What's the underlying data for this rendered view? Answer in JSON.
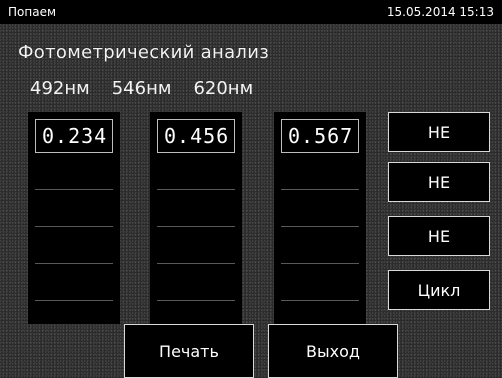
{
  "window": {
    "title": "Попаем",
    "datetime": "15.05.2014 15:13"
  },
  "panel": {
    "heading": "Фотометрический анализ",
    "wavelengths": [
      "492нм",
      "546нм",
      "620нм"
    ]
  },
  "measurements": {
    "columns": [
      {
        "value": "0.234"
      },
      {
        "value": "0.456"
      },
      {
        "value": "0.567"
      }
    ]
  },
  "side_buttons": {
    "b1": "НЕ",
    "b2": "НЕ",
    "b3": "НЕ",
    "b4": "Цикл"
  },
  "footer": {
    "print": "Печать",
    "exit": "Выход"
  }
}
